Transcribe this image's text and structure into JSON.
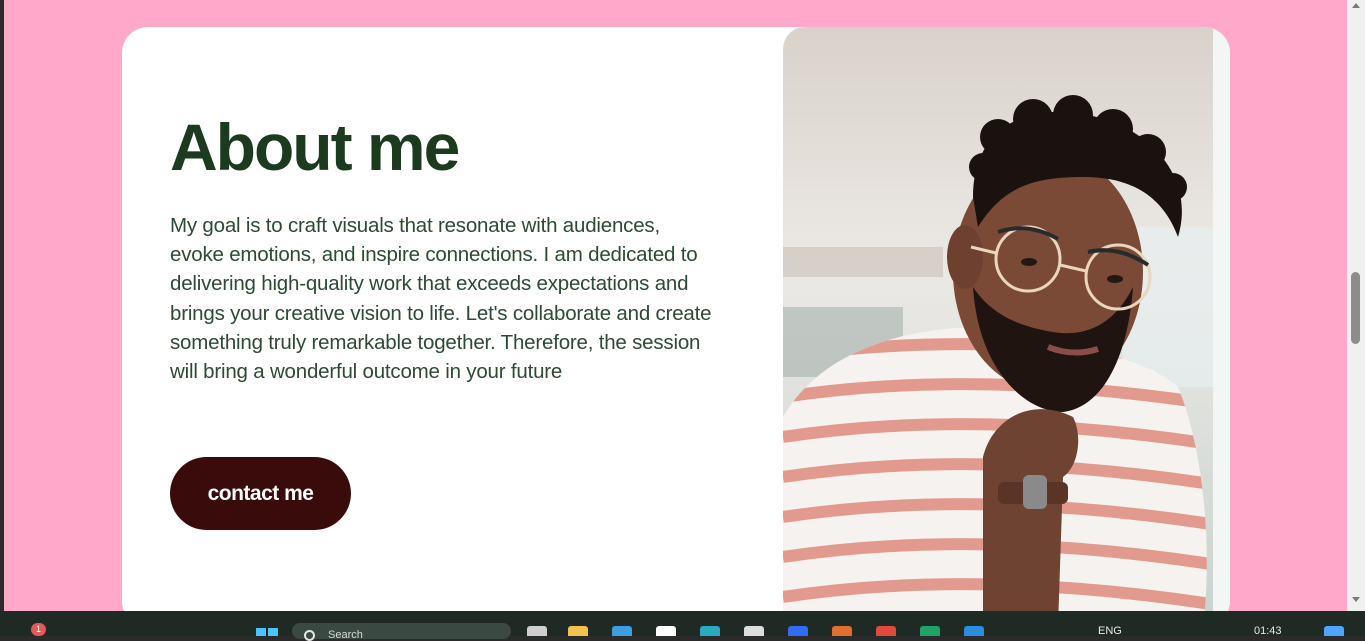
{
  "about": {
    "title": "About me",
    "description": "My goal is to craft visuals that resonate with audiences, evoke emotions, and inspire connections. I am dedicated to delivering high-quality work that exceeds expectations and brings your creative vision to life. Let's collaborate and create something truly remarkable together. Therefore, the session will bring a wonderful outcome in your future",
    "button_label": "contact me",
    "photo_icon": "portrait-photo"
  },
  "colors": {
    "page_background": "#ffa8c9",
    "card_background": "#ffffff",
    "title_color": "#1b3a1e",
    "text_color": "#2c4a34",
    "button_background": "#3a0b0b",
    "button_text": "#ffffff"
  },
  "taskbar": {
    "notification_count": "1",
    "search_placeholder": "Search",
    "language": "ENG",
    "time": "01:43",
    "icons": [
      "start-icon",
      "search-icon",
      "file-explorer-icon",
      "store-icon",
      "edge-icon",
      "dropbox-icon",
      "chrome-icon",
      "excel-icon",
      "vscode-icon",
      "copilot-icon"
    ]
  }
}
